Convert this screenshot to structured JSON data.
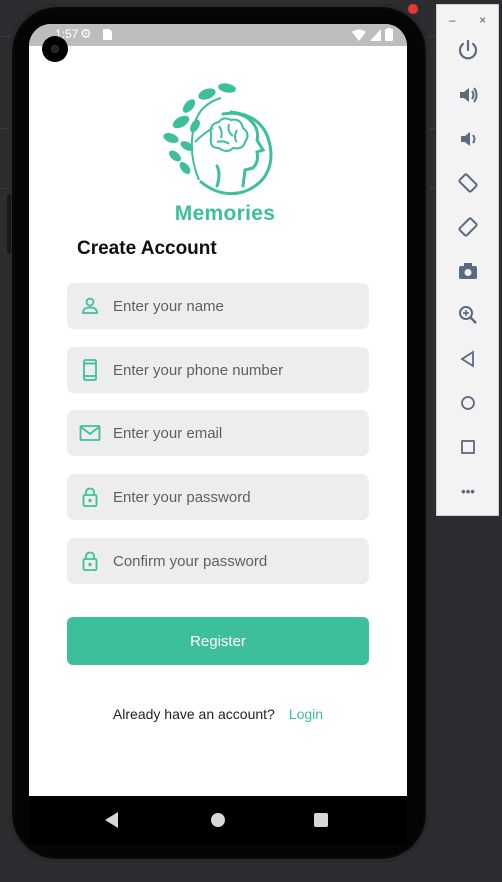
{
  "status": {
    "time": "1:57"
  },
  "app": {
    "name": "Memories",
    "heading": "Create Account"
  },
  "form": {
    "name_placeholder": "Enter your name",
    "phone_placeholder": "Enter your phone number",
    "email_placeholder": "Enter your email",
    "password_placeholder": "Enter your password",
    "confirm_placeholder": "Confirm your password",
    "register_label": "Register"
  },
  "login": {
    "question": "Already have an account?",
    "link": "Login"
  },
  "toolbar": {
    "minimize": "–",
    "close": "×",
    "more": "•••"
  },
  "colors": {
    "accent": "#3dbf9e",
    "field_bg": "#ededed"
  },
  "icons": [
    "person-icon",
    "phone-icon",
    "mail-icon",
    "lock-icon",
    "lock-icon"
  ]
}
